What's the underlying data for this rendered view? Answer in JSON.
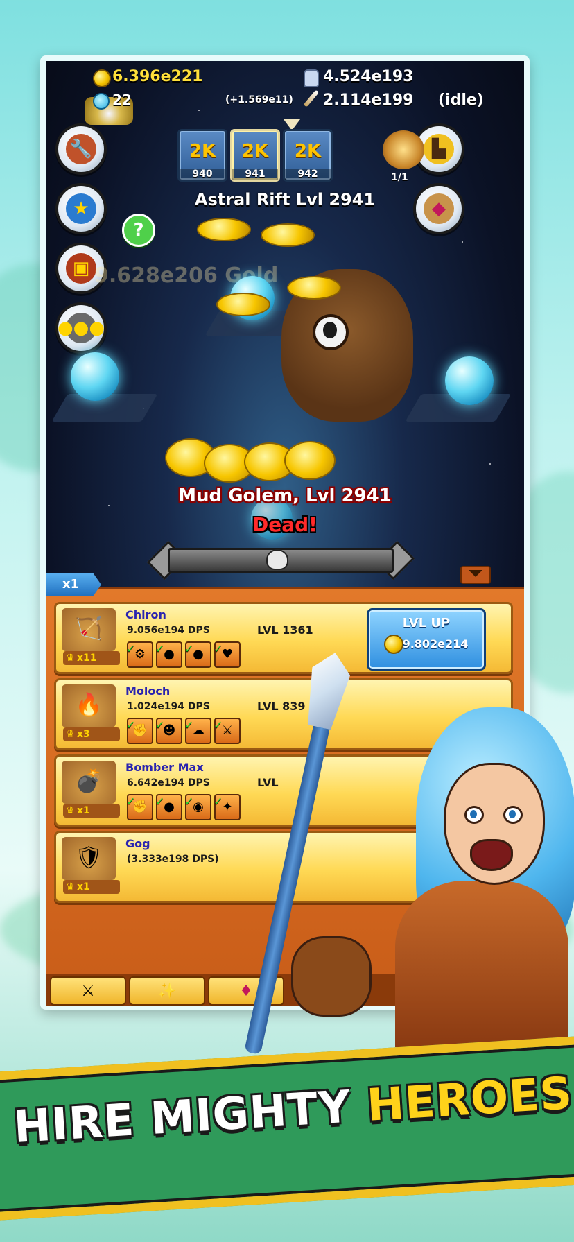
{
  "resources": {
    "gold": "6.396e221",
    "rubies": "22",
    "dps_change": "(+1.569e11)",
    "hero_souls": "4.524e193",
    "dps": "2.114e199",
    "mode": "(idle)"
  },
  "zones": [
    {
      "label": "2K",
      "number": "940"
    },
    {
      "label": "2K",
      "number": "941"
    },
    {
      "label": "2K",
      "number": "942"
    }
  ],
  "boss_counter": "1/1",
  "zone_title": "Astral Rift Lvl 2941",
  "faded_text": "9.628e206 Gold",
  "monster": {
    "name": "Mud Golem, Lvl 2941",
    "status": "Dead!"
  },
  "help_label": "?",
  "multiplier_tab": "x1",
  "heroes": [
    {
      "name": "Chiron",
      "dps": "9.056e194 DPS",
      "level": "LVL 1361",
      "gild": "x11",
      "button_label": "LVL UP",
      "cost": "9.802e214",
      "emoji": "🏹"
    },
    {
      "name": "Moloch",
      "dps": "1.024e194 DPS",
      "level": "LVL 839",
      "gild": "x3",
      "emoji": "🔥"
    },
    {
      "name": "Bomber Max",
      "dps": "6.642e194 DPS",
      "level": "LVL",
      "gild": "x1",
      "emoji": "💣"
    },
    {
      "name": "Gog",
      "dps": "(3.333e198 DPS)",
      "gild": "x1",
      "emoji": "🛡"
    }
  ],
  "banner": {
    "part1": "HIRE MIGHTY",
    "part2": "HEROES!"
  },
  "icons": {
    "settings": "wrench-icon",
    "achievements": "stars-icon",
    "shop": "treasure-icon",
    "clan": "clan-icon",
    "boots": "boots-icon",
    "bag": "gem-bag-icon",
    "tab_heroes": "crossed-swords-icon",
    "tab_skills": "magic-wand-icon",
    "tab_shop": "ruby-icon"
  },
  "colors": {
    "gold_text": "#ffe03a",
    "hero_name": "#2a24b0",
    "status_dead": "#ff2a2a",
    "banner_green": "#2f9a5a",
    "banner_yellow": "#ffd21a"
  }
}
